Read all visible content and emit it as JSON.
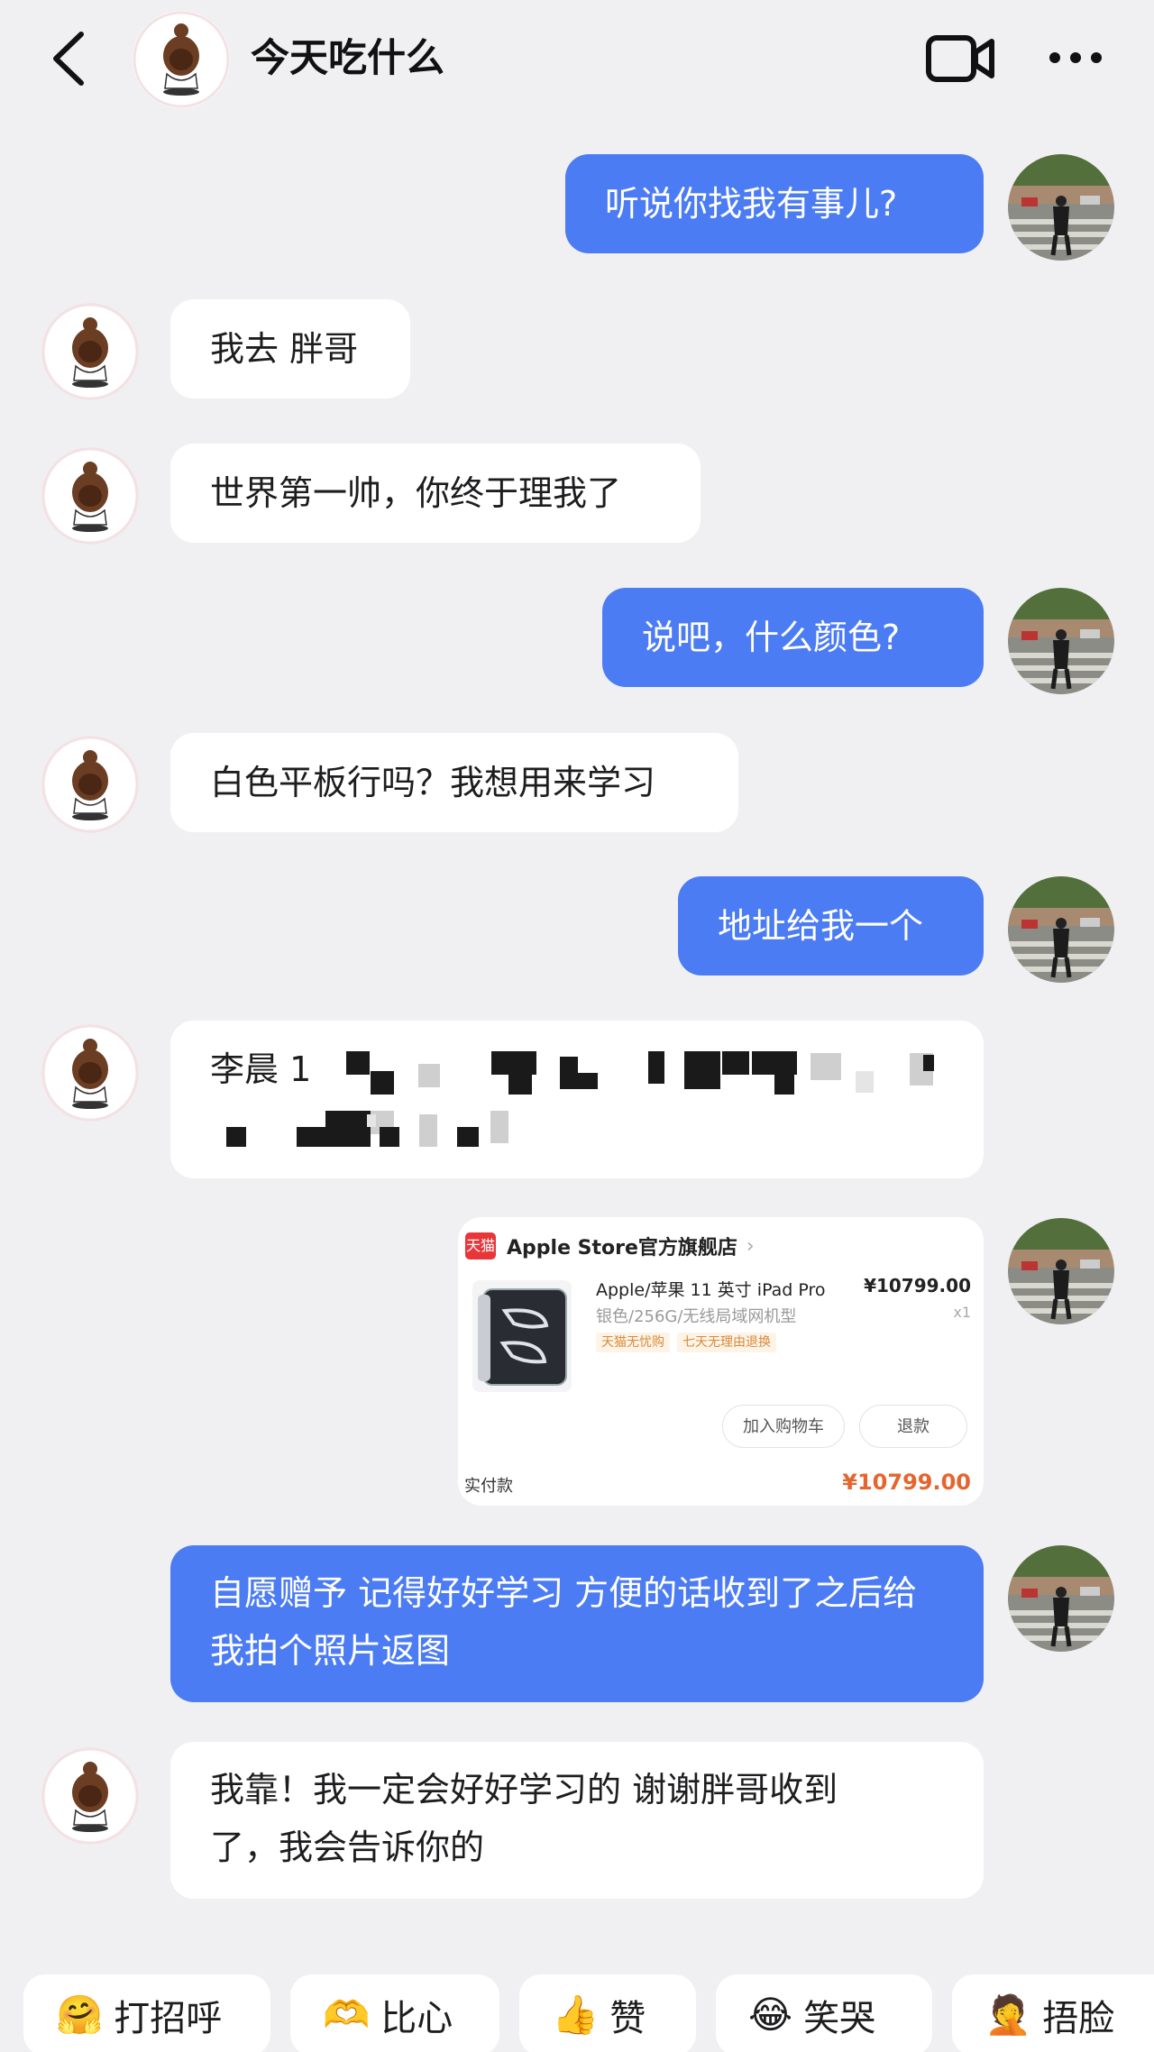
{
  "header": {
    "title": "今天吃什么"
  },
  "messages": {
    "m1": "听说你找我有事儿?",
    "m2": "我去 胖哥",
    "m3": "世界第一帅，你终于理我了",
    "m4": "说吧，什么颜色?",
    "m5": "白色平板行吗？我想用来学习",
    "m6": "地址给我一个",
    "m7_prefix": "李晨 1",
    "m9": "自愿赠予 记得好好学习 方便的话收到了之后给我拍个照片返图",
    "m10": "我靠！我一定会好好学习的 谢谢胖哥收到了，我会告诉你的"
  },
  "order": {
    "badge": "天猫",
    "shop_name": "Apple Store官方旗舰店",
    "product_title": "Apple/苹果 11 英寸 iPad Pro",
    "product_spec": "银色/256G/无线局域网机型",
    "tags": [
      "天猫无忧购",
      "七天无理由退换"
    ],
    "price": "¥10799.00",
    "qty": "x1",
    "btn_cart": "加入购物车",
    "btn_refund": "退款",
    "paid_label": "实付款",
    "paid_amount": "¥10799.00"
  },
  "quick_replies": [
    {
      "label": "打招呼",
      "emoji": "🤗"
    },
    {
      "label": "比心",
      "emoji": "🫶"
    },
    {
      "label": "赞",
      "emoji": "👍"
    },
    {
      "label": "笑哭",
      "emoji": "😂"
    },
    {
      "label": "捂脸",
      "emoji": "🤦"
    }
  ],
  "colors": {
    "background": "#f0f0f2",
    "self_bubble": "#4c7cf3",
    "peer_bubble": "#ffffff",
    "price": "#e6652e"
  }
}
